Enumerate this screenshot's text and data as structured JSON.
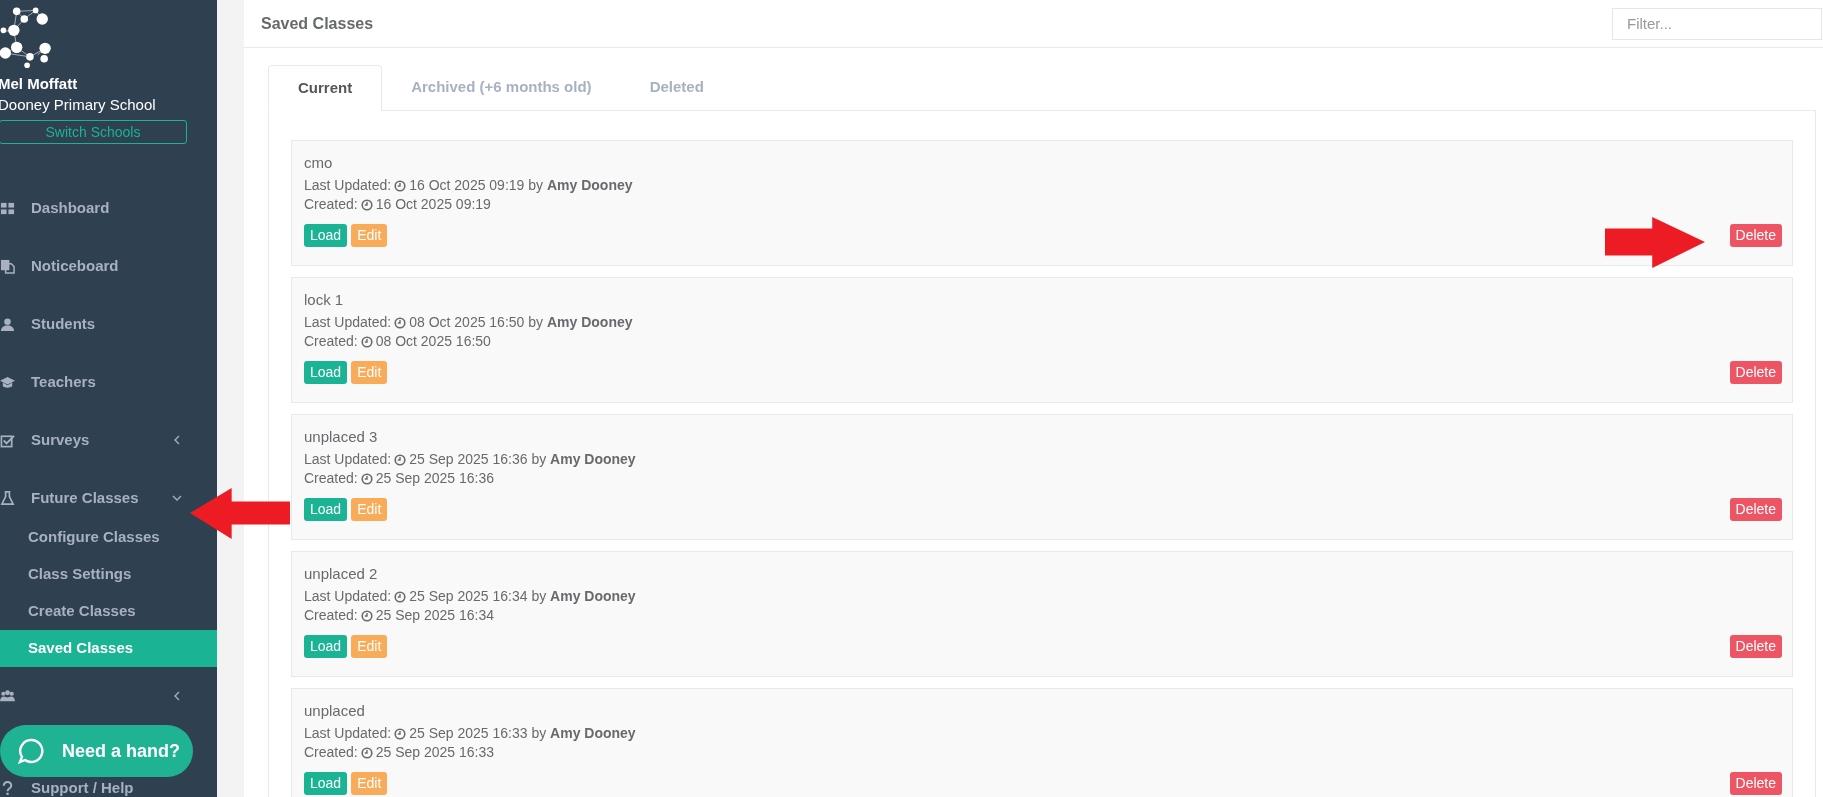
{
  "sidebar": {
    "user_name": "Mel Moffatt",
    "school": "Dooney Primary School",
    "switch_button": "Switch Schools",
    "menu": [
      {
        "kind": "link",
        "label": "Dashboard"
      },
      {
        "kind": "link",
        "label": "Noticeboard"
      },
      {
        "kind": "link",
        "label": "Students"
      },
      {
        "kind": "link",
        "label": "Teachers"
      },
      {
        "kind": "group",
        "label": "Surveys",
        "expanded": false
      },
      {
        "kind": "group",
        "label": "Future Classes",
        "expanded": true,
        "children": [
          {
            "label": "Configure Classes",
            "selected": false
          },
          {
            "label": "Class Settings",
            "selected": false
          },
          {
            "label": "Create Classes",
            "selected": false
          },
          {
            "label": "Saved Classes",
            "selected": true
          }
        ]
      },
      {
        "kind": "group",
        "expanded": false
      },
      {
        "kind": "link",
        "label": "Support / Help"
      }
    ]
  },
  "help_widget": {
    "label": "Need a hand?"
  },
  "panel": {
    "title": "Saved Classes",
    "filter": {
      "placeholder": "Filter..."
    }
  },
  "tabs": [
    {
      "label": "Current",
      "selected": true
    },
    {
      "label": "Archived (+6 months old)",
      "selected": false
    },
    {
      "label": "Deleted",
      "selected": false
    }
  ],
  "saved_classes": [
    {
      "name": "cmo",
      "updated_label": "Last Updated:",
      "updated": "16 Oct 2025 09:19 by **Amy Dooney**",
      "created_label": "Created:",
      "created": "16 Oct 2025 09:19",
      "buttons": [
        {
          "kind": "load",
          "label": "Load"
        },
        {
          "kind": "edit",
          "label": "Edit"
        },
        {
          "kind": "delete",
          "label": "Delete"
        }
      ]
    },
    {
      "name": "lock 1",
      "updated_label": "Last Updated:",
      "updated": "08 Oct 2025 16:50 by **Amy Dooney**",
      "created_label": "Created:",
      "created": "08 Oct 2025 16:50",
      "buttons": [
        {
          "kind": "load",
          "label": "Load"
        },
        {
          "kind": "edit",
          "label": "Edit"
        },
        {
          "kind": "delete",
          "label": "Delete"
        }
      ]
    },
    {
      "name": "unplaced 3",
      "updated_label": "Last Updated:",
      "updated": "25 Sep 2025 16:36 by **Amy Dooney**",
      "created_label": "Created:",
      "created": "25 Sep 2025 16:36",
      "buttons": [
        {
          "kind": "load",
          "label": "Load"
        },
        {
          "kind": "edit",
          "label": "Edit"
        },
        {
          "kind": "delete",
          "label": "Delete"
        }
      ]
    },
    {
      "name": "unplaced 2",
      "updated_label": "Last Updated:",
      "updated": "25 Sep 2025 16:34 by **Amy Dooney**",
      "created_label": "Created:",
      "created": "25 Sep 2025 16:34",
      "buttons": [
        {
          "kind": "load",
          "label": "Load"
        },
        {
          "kind": "edit",
          "label": "Edit"
        },
        {
          "kind": "delete",
          "label": "Delete"
        }
      ]
    },
    {
      "name": "unplaced",
      "updated_label": "Last Updated:",
      "updated": "25 Sep 2025 16:33 by **Amy Dooney**",
      "created_label": "Created:",
      "created": "25 Sep 2025 16:33",
      "buttons": [
        {
          "kind": "load",
          "label": "Load"
        },
        {
          "kind": "edit",
          "label": "Edit"
        },
        {
          "kind": "delete",
          "label": "Delete"
        }
      ]
    }
  ],
  "annotations": [
    {
      "kind": "arrow_left"
    },
    {
      "kind": "arrow_right"
    }
  ]
}
